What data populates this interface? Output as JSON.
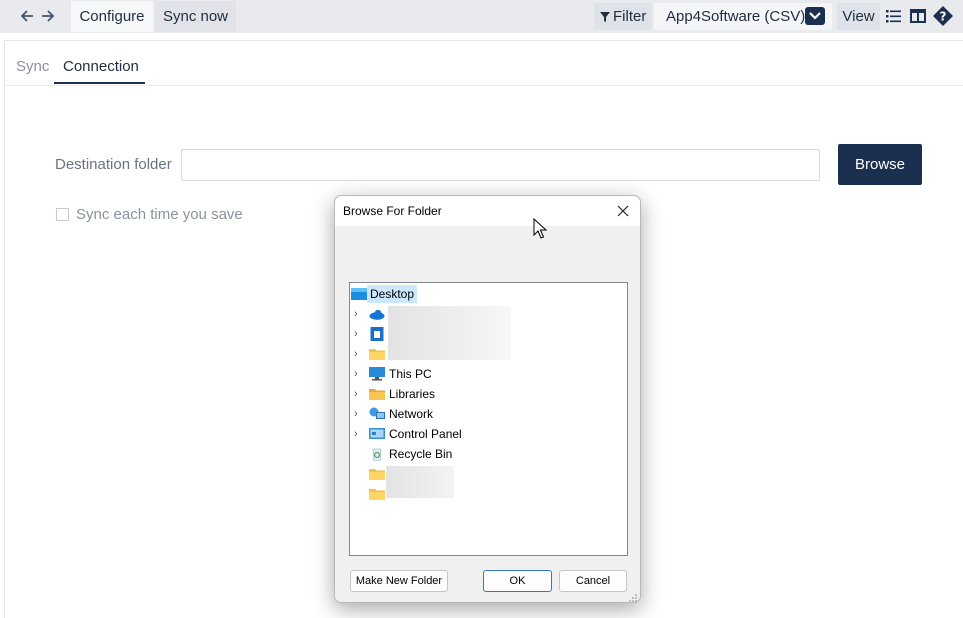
{
  "toolbar": {
    "back_icon": "arrow-left-icon",
    "forward_icon": "arrow-right-icon",
    "tabs": [
      {
        "label": "Configure",
        "active": true
      },
      {
        "label": "Sync now",
        "active": false
      }
    ],
    "filter_label": "Filter",
    "filter_icon": "funnel-icon",
    "source_value": "App4Software (CSV)",
    "view_label": "View",
    "icons": [
      "list-icon",
      "layout-icon",
      "help-icon"
    ]
  },
  "subtabs": [
    {
      "label": "Sync",
      "active": false
    },
    {
      "label": "Connection",
      "active": true
    }
  ],
  "form": {
    "destination_label": "Destination folder",
    "destination_value": "",
    "browse_label": "Browse",
    "sync_checkbox_label": "Sync each time you save",
    "sync_checked": false
  },
  "dialog": {
    "title": "Browse For Folder",
    "tree": [
      {
        "label": "Desktop",
        "icon": "desktop-icon",
        "selected": true,
        "expandable": false
      },
      {
        "label": "",
        "icon": "onedrive-cloud-icon",
        "expandable": true
      },
      {
        "label": "",
        "icon": "user-folder-icon",
        "expandable": true
      },
      {
        "label": "",
        "icon": "folder-icon",
        "expandable": true
      },
      {
        "label": "This PC",
        "icon": "computer-icon",
        "expandable": true
      },
      {
        "label": "Libraries",
        "icon": "libraries-folder-icon",
        "expandable": true
      },
      {
        "label": "Network",
        "icon": "network-icon",
        "expandable": true
      },
      {
        "label": "Control Panel",
        "icon": "control-panel-icon",
        "expandable": true
      },
      {
        "label": "Recycle Bin",
        "icon": "recycle-bin-icon",
        "expandable": false
      },
      {
        "label": "",
        "icon": "folder-icon",
        "expandable": false
      },
      {
        "label": "",
        "icon": "folder-icon",
        "expandable": false
      }
    ],
    "make_new_folder_label": "Make New Folder",
    "ok_label": "OK",
    "cancel_label": "Cancel"
  },
  "colors": {
    "accent": "#1b2f4e",
    "toolbar_bg": "#e9eaee",
    "selection": "#cce8ff"
  }
}
